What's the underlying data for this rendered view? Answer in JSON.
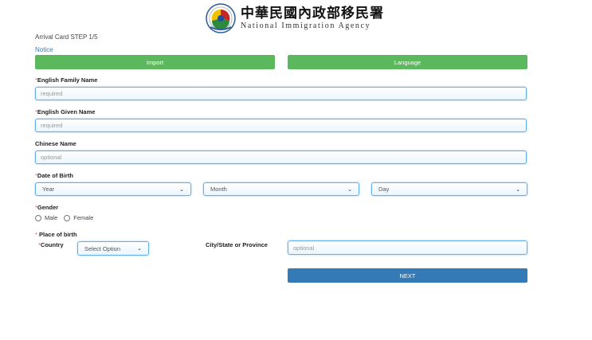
{
  "header": {
    "title_zh": "中華民國內政部移民署",
    "title_en": "National Immigration Agency"
  },
  "step_text": "Arrival Card STEP 1/5",
  "notice_link": "Notice",
  "buttons": {
    "import": "Import",
    "language": "Language",
    "next": "NEXT"
  },
  "fields": {
    "family_name": {
      "label": "English Family Name",
      "placeholder": "required",
      "required_mark": "*"
    },
    "given_name": {
      "label": "English Given Name",
      "placeholder": "required",
      "required_mark": "*"
    },
    "chinese_name": {
      "label": "Chinese Name",
      "placeholder": "optional"
    },
    "dob": {
      "label": "Date of Birth",
      "required_mark": "*",
      "year": "Year",
      "month": "Month",
      "day": "Day"
    },
    "gender": {
      "label": "Gender",
      "required_mark": "*",
      "male": "Male",
      "female": "Female"
    },
    "place_of_birth": {
      "label": "Place of birth",
      "required_mark": "* "
    },
    "country": {
      "label": "Country",
      "required_mark": "*",
      "value": "Select Option"
    },
    "city": {
      "label": "City/State or Province",
      "placeholder": "optional"
    }
  },
  "colors": {
    "green": "#5cb85c",
    "blue": "#337ab7",
    "focus_border": "#66afe9"
  },
  "icons": {
    "chevron": "chevron-down-icon",
    "logo": "emblem-logo"
  }
}
